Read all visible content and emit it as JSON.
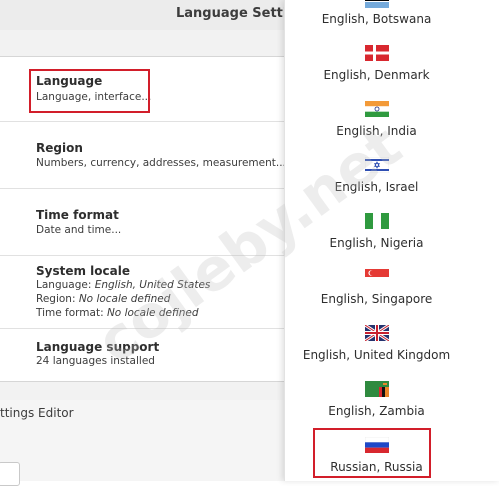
{
  "window": {
    "title": "Language Settings"
  },
  "settings": {
    "language": {
      "title": "Language",
      "subtitle": "Language, interface..."
    },
    "region": {
      "title": "Region",
      "subtitle": "Numbers, currency, addresses, measurement..."
    },
    "time_format": {
      "title": "Time format",
      "subtitle": "Date and time..."
    },
    "system_locale": {
      "title": "System locale",
      "language_label": "Language:",
      "language_value": "English, United States",
      "region_label": "Region:",
      "region_value": "No locale defined",
      "time_label": "Time format:",
      "time_value": "No locale defined"
    },
    "language_support": {
      "title": "Language support",
      "subtitle": "24 languages installed"
    }
  },
  "below_window": {
    "text": "ttings Editor"
  },
  "dropdown": {
    "items": [
      {
        "label": "English, Botswana",
        "flag": "botswana-flag"
      },
      {
        "label": "English, Denmark",
        "flag": "denmark-flag"
      },
      {
        "label": "English, India",
        "flag": "india-flag"
      },
      {
        "label": "English, Israel",
        "flag": "israel-flag"
      },
      {
        "label": "English, Nigeria",
        "flag": "nigeria-flag"
      },
      {
        "label": "English, Singapore",
        "flag": "singapore-flag"
      },
      {
        "label": "English, United Kingdom",
        "flag": "united-kingdom-flag"
      },
      {
        "label": "English, Zambia",
        "flag": "zambia-flag"
      },
      {
        "label": "Russian, Russia",
        "flag": "russia-flag"
      }
    ]
  },
  "watermark": {
    "text": "cojleby.net"
  },
  "colors": {
    "highlight": "#d21e2a"
  }
}
